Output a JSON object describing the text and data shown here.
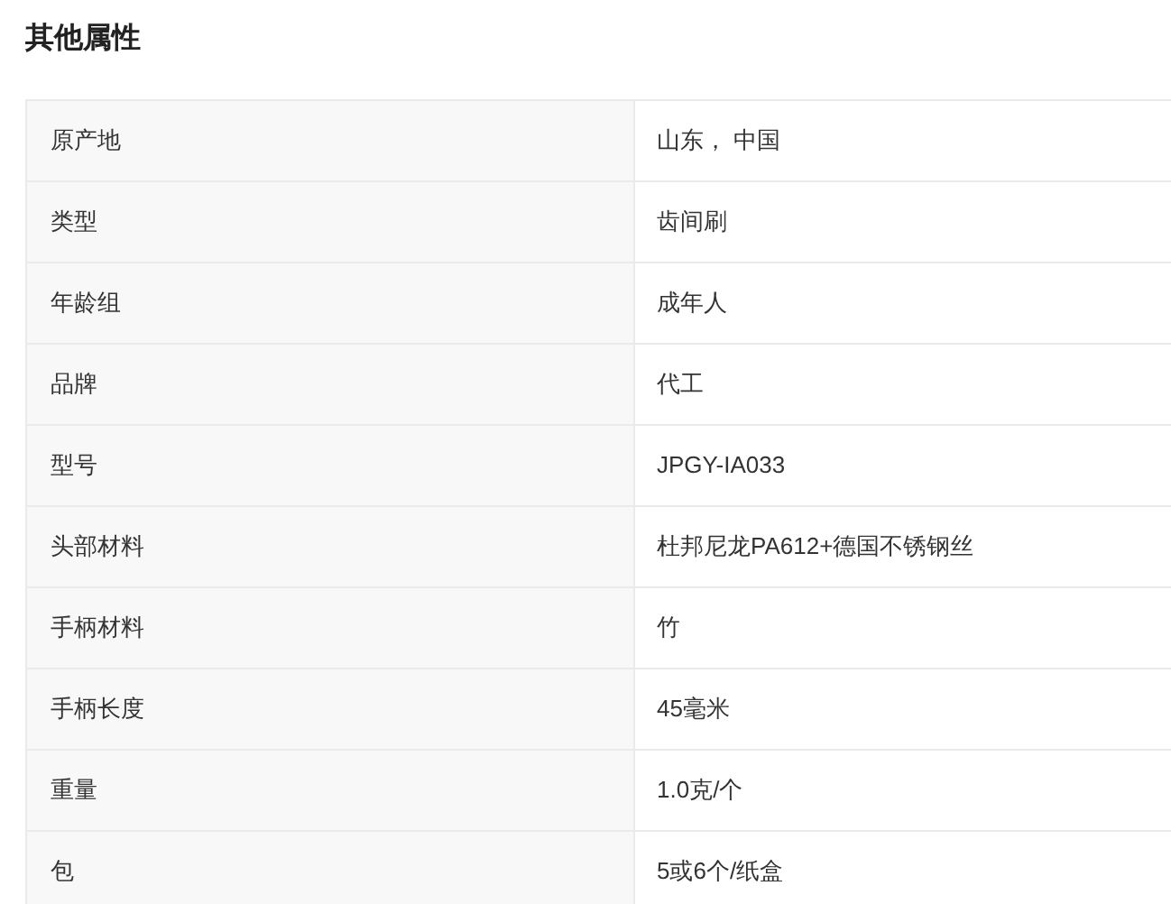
{
  "title": "其他属性",
  "rows": [
    {
      "label": "原产地",
      "value": "山东， 中国"
    },
    {
      "label": "类型",
      "value": "齿间刷"
    },
    {
      "label": "年龄组",
      "value": "成年人"
    },
    {
      "label": "品牌",
      "value": "代工"
    },
    {
      "label": "型号",
      "value": "JPGY-IA033"
    },
    {
      "label": "头部材料",
      "value": "杜邦尼龙PA612+德国不锈钢丝"
    },
    {
      "label": "手柄材料",
      "value": "竹"
    },
    {
      "label": "手柄长度",
      "value": "45毫米"
    },
    {
      "label": "重量",
      "value": "1.0克/个"
    },
    {
      "label": "包",
      "value": "5或6个/纸盒"
    }
  ]
}
